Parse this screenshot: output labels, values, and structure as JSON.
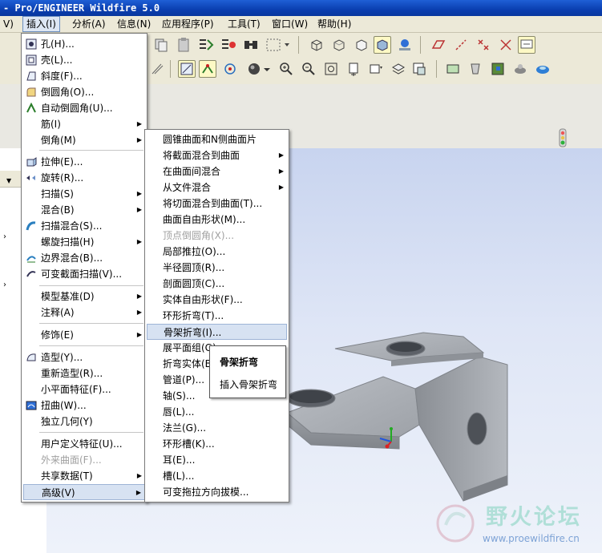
{
  "window": {
    "title": "- Pro/ENGINEER Wildfire 5.0"
  },
  "menubar": {
    "items": [
      {
        "label": "V)"
      },
      {
        "label": "插入(I)"
      },
      {
        "label": "分析(A)"
      },
      {
        "label": "信息(N)"
      },
      {
        "label": "应用程序(P)"
      },
      {
        "label": "工具(T)"
      },
      {
        "label": "窗口(W)"
      },
      {
        "label": "帮助(H)"
      }
    ]
  },
  "insert_menu": {
    "items": [
      {
        "label": "孔(H)...",
        "icon": "hole-icon"
      },
      {
        "label": "壳(L)...",
        "icon": "shell-icon"
      },
      {
        "label": "斜度(F)...",
        "icon": "draft-icon"
      },
      {
        "label": "倒圆角(O)...",
        "icon": "round-icon"
      },
      {
        "label": "自动倒圆角(U)...",
        "icon": "auto-round-icon"
      },
      {
        "label": "筋(I)",
        "submenu": true
      },
      {
        "label": "倒角(M)",
        "submenu": true
      },
      {
        "label": "拉伸(E)...",
        "icon": "extrude-icon"
      },
      {
        "label": "旋转(R)...",
        "icon": "revolve-icon"
      },
      {
        "label": "扫描(S)",
        "submenu": true
      },
      {
        "label": "混合(B)",
        "submenu": true
      },
      {
        "label": "扫描混合(S)...",
        "icon": "swept-blend-icon"
      },
      {
        "label": "螺旋扫描(H)",
        "submenu": true
      },
      {
        "label": "边界混合(B)...",
        "icon": "boundary-blend-icon"
      },
      {
        "label": "可变截面扫描(V)...",
        "icon": "var-sec-sweep-icon"
      },
      {
        "label": "模型基准(D)",
        "submenu": true
      },
      {
        "label": "注释(A)",
        "submenu": true
      },
      {
        "label": "修饰(E)",
        "submenu": true
      },
      {
        "label": "造型(Y)...",
        "icon": "style-icon"
      },
      {
        "label": "重新造型(R)...",
        "icon": ""
      },
      {
        "label": "小平面特征(F)...",
        "icon": ""
      },
      {
        "label": "扭曲(W)...",
        "icon": "warp-icon"
      },
      {
        "label": "独立几何(Y)",
        "icon": ""
      },
      {
        "label": "用户定义特征(U)...",
        "icon": ""
      },
      {
        "label": "外来曲面(F)...",
        "disabled": true
      },
      {
        "label": "共享数据(T)",
        "submenu": true
      },
      {
        "label": "高级(V)",
        "submenu": true,
        "highlighted": true
      }
    ]
  },
  "advanced_submenu": {
    "items": [
      {
        "label": "圆锥曲面和N侧曲面片"
      },
      {
        "label": "将截面混合到曲面",
        "submenu": true
      },
      {
        "label": "在曲面间混合",
        "submenu": true
      },
      {
        "label": "从文件混合",
        "submenu": true
      },
      {
        "label": "将切面混合到曲面(T)..."
      },
      {
        "label": "曲面自由形状(M)..."
      },
      {
        "label": "顶点倒圆角(X)...",
        "disabled": true
      },
      {
        "label": "局部推拉(O)..."
      },
      {
        "label": "半径圆顶(R)..."
      },
      {
        "label": "剖面圆顶(C)..."
      },
      {
        "label": "实体自由形状(F)..."
      },
      {
        "label": "环形折弯(T)..."
      },
      {
        "label": "骨架折弯(I)...",
        "highlighted": true
      },
      {
        "label": "展平面组(G)..."
      },
      {
        "label": "折弯实体(B)..."
      },
      {
        "label": "管道(P)..."
      },
      {
        "label": "轴(S)..."
      },
      {
        "label": "唇(L)..."
      },
      {
        "label": "法兰(G)..."
      },
      {
        "label": "环形槽(K)..."
      },
      {
        "label": "耳(E)..."
      },
      {
        "label": "槽(L)..."
      },
      {
        "label": "可变拖拉方向拔模..."
      }
    ]
  },
  "tooltip": {
    "title": "骨架折弯",
    "description": "插入骨架折弯"
  },
  "watermark": {
    "name": "野火论坛",
    "url": "www.proewildfire.cn"
  },
  "colors": {
    "menu_highlight": "#d7e2f2",
    "titlebar": "#0a3fb0",
    "viewport_bg": "#d6def2",
    "part": "#a9adb3"
  }
}
